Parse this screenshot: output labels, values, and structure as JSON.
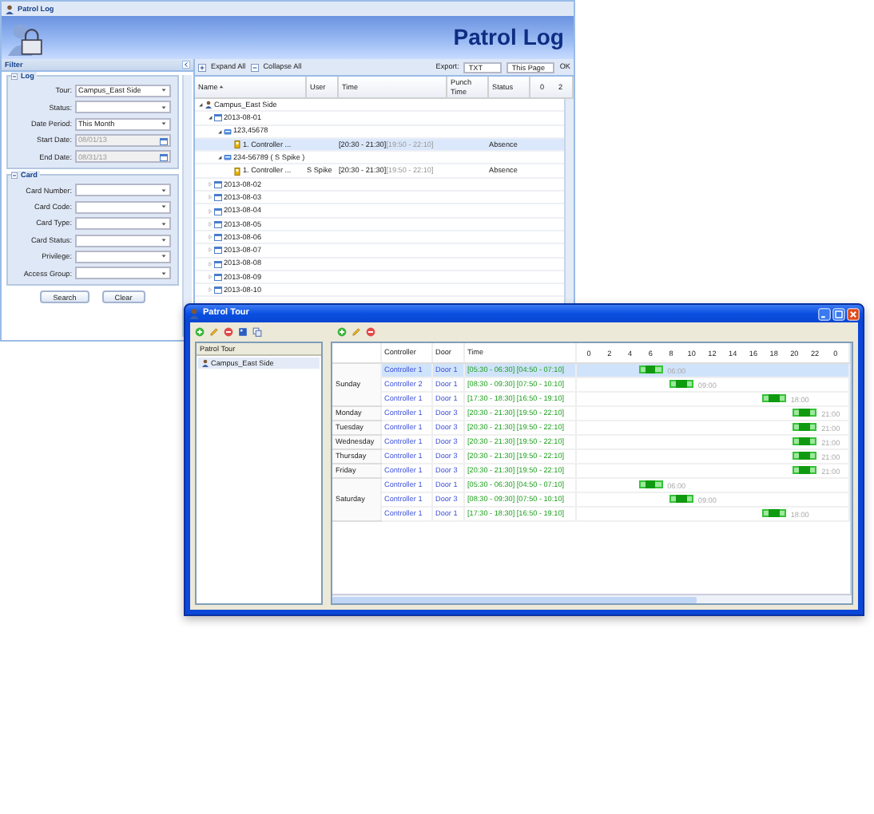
{
  "log_window": {
    "title": "Patrol Log",
    "banner_title": "Patrol Log",
    "filter": {
      "title": "Filter",
      "sections": [
        {
          "title": "Log",
          "fields": [
            {
              "label": "Tour:",
              "kind": "select",
              "value": "Campus_East Side",
              "disabled": false
            },
            {
              "label": "Status:",
              "kind": "select",
              "disabled": false
            },
            {
              "label": "Date Period:",
              "kind": "select",
              "value": "This Month",
              "disabled": false
            },
            {
              "label": "Start Date:",
              "kind": "date",
              "value": "08/01/13",
              "disabled": true
            },
            {
              "label": "End Date:",
              "kind": "date",
              "value": "08/31/13",
              "disabled": true
            }
          ]
        },
        {
          "title": "Card",
          "fields": [
            {
              "label": "Card Number:",
              "kind": "select",
              "disabled": false
            },
            {
              "label": "Card Code:",
              "kind": "select",
              "disabled": false
            },
            {
              "label": "Card Type:",
              "kind": "select",
              "disabled": false
            },
            {
              "label": "Card Status:",
              "kind": "select",
              "disabled": false
            },
            {
              "label": "Privilege:",
              "kind": "select",
              "disabled": false
            },
            {
              "label": "Access Group:",
              "kind": "select",
              "disabled": false
            }
          ]
        }
      ],
      "buttons": [
        "Search",
        "Clear"
      ]
    },
    "toolbar": {
      "expand_all": "Expand All",
      "collapse_all": "Collapse All",
      "export_label": "Export:",
      "export_format": "TXT",
      "export_scope": "This Page",
      "ok": "OK"
    },
    "columns": [
      "Name",
      "User",
      "Time",
      "Punch Time",
      "Status"
    ],
    "timeline_ticks": [
      "0",
      "2"
    ],
    "tree": [
      {
        "kind": "site",
        "label": "Campus_East Side",
        "expanded": true,
        "selected": false,
        "children": [
          {
            "kind": "date",
            "label": "2013-08-01",
            "expanded": true,
            "selected": false,
            "children": [
              {
                "kind": "card",
                "label": "123,45678",
                "expanded": true,
                "selected": false,
                "children": [
                  {
                    "kind": "checkpoint",
                    "label": "1. Controller ...",
                    "time": "[20:30 - 21:30]",
                    "window": "[19:50 - 22:10]",
                    "status": "Absence",
                    "selected": true
                  }
                ]
              },
              {
                "kind": "card",
                "label": "234-56789 ( S Spike )",
                "expanded": true,
                "selected": false,
                "children": [
                  {
                    "kind": "checkpoint",
                    "label": "1. Controller ...",
                    "user": "S Spike",
                    "time": "[20:30 - 21:30]",
                    "window": "[19:50 - 22:10]",
                    "status": "Absence",
                    "selected": false
                  }
                ]
              }
            ]
          },
          {
            "kind": "date",
            "label": "2013-08-02",
            "expanded": false,
            "selected": false
          },
          {
            "kind": "date",
            "label": "2013-08-03",
            "expanded": false,
            "selected": false
          },
          {
            "kind": "date",
            "label": "2013-08-04",
            "expanded": false,
            "selected": false
          },
          {
            "kind": "date",
            "label": "2013-08-05",
            "expanded": false,
            "selected": false
          },
          {
            "kind": "date",
            "label": "2013-08-06",
            "expanded": false,
            "selected": false
          },
          {
            "kind": "date",
            "label": "2013-08-07",
            "expanded": false,
            "selected": false
          },
          {
            "kind": "date",
            "label": "2013-08-08",
            "expanded": false,
            "selected": false
          },
          {
            "kind": "date",
            "label": "2013-08-09",
            "expanded": false,
            "selected": false
          },
          {
            "kind": "date",
            "label": "2013-08-10",
            "expanded": false,
            "selected": false
          }
        ]
      }
    ]
  },
  "tour_window": {
    "title": "Patrol Tour",
    "tours_header": "Patrol Tour",
    "tours": [
      {
        "label": "Campus_East Side",
        "selected": true
      }
    ],
    "columns": [
      "Controller",
      "Door",
      "Time"
    ],
    "ticks": [
      "0",
      "2",
      "4",
      "6",
      "8",
      "10",
      "12",
      "14",
      "16",
      "18",
      "20",
      "22",
      "0"
    ],
    "days": [
      {
        "day": "Sunday",
        "entries": [
          {
            "controller": "Controller 1",
            "door": "Door 1",
            "time": "[05:30 - 06:30]",
            "window": "[04:50 - 07:10]",
            "marker": "06:00",
            "selected": true
          },
          {
            "controller": "Controller 2",
            "door": "Door 1",
            "time": "[08:30 - 09:30]",
            "window": "[07:50 - 10:10]",
            "marker": "09:00",
            "selected": false
          },
          {
            "controller": "Controller 1",
            "door": "Door 1",
            "time": "[17:30 - 18:30]",
            "window": "[16:50 - 19:10]",
            "marker": "18:00",
            "selected": false
          }
        ]
      },
      {
        "day": "Monday",
        "entries": [
          {
            "controller": "Controller 1",
            "door": "Door 3",
            "time": "[20:30 - 21:30]",
            "window": "[19:50 - 22:10]",
            "marker": "21:00",
            "selected": false
          }
        ]
      },
      {
        "day": "Tuesday",
        "entries": [
          {
            "controller": "Controller 1",
            "door": "Door 3",
            "time": "[20:30 - 21:30]",
            "window": "[19:50 - 22:10]",
            "marker": "21:00",
            "selected": false
          }
        ]
      },
      {
        "day": "Wednesday",
        "entries": [
          {
            "controller": "Controller 1",
            "door": "Door 3",
            "time": "[20:30 - 21:30]",
            "window": "[19:50 - 22:10]",
            "marker": "21:00",
            "selected": false
          }
        ]
      },
      {
        "day": "Thursday",
        "entries": [
          {
            "controller": "Controller 1",
            "door": "Door 3",
            "time": "[20:30 - 21:30]",
            "window": "[19:50 - 22:10]",
            "marker": "21:00",
            "selected": false
          }
        ]
      },
      {
        "day": "Friday",
        "entries": [
          {
            "controller": "Controller 1",
            "door": "Door 3",
            "time": "[20:30 - 21:30]",
            "window": "[19:50 - 22:10]",
            "marker": "21:00",
            "selected": false
          }
        ]
      },
      {
        "day": "Saturday",
        "entries": [
          {
            "controller": "Controller 1",
            "door": "Door 1",
            "time": "[05:30 - 06:30]",
            "window": "[04:50 - 07:10]",
            "marker": "06:00",
            "selected": false
          },
          {
            "controller": "Controller 1",
            "door": "Door 3",
            "time": "[08:30 - 09:30]",
            "window": "[07:50 - 10:10]",
            "marker": "09:00",
            "selected": false
          },
          {
            "controller": "Controller 1",
            "door": "Door 1",
            "time": "[17:30 - 18:30]",
            "window": "[16:50 - 19:10]",
            "marker": "18:00",
            "selected": false
          }
        ]
      }
    ]
  }
}
